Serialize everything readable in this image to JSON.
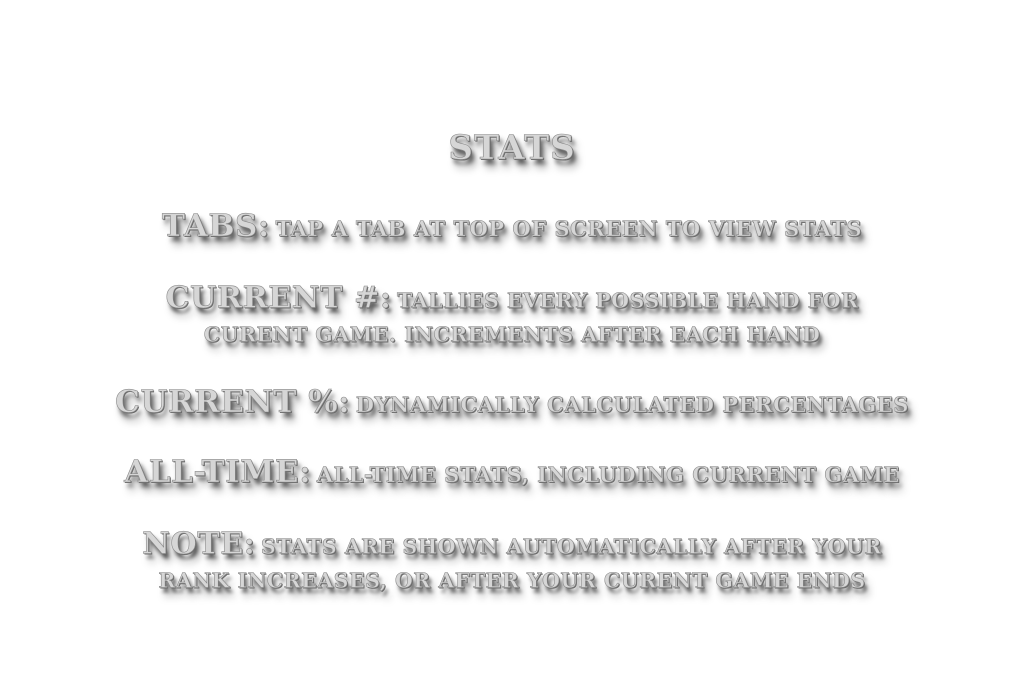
{
  "title": "STATS",
  "items": [
    {
      "key": "TABS:",
      "desc": "TAP A TAB AT TOP OF SCREEN TO VIEW STATS",
      "desc_line2": ""
    },
    {
      "key": "CURRENT #:",
      "desc": "TALLIES EVERY POSSIBLE HAND FOR",
      "desc_line2": "CURENT GAME. INCREMENTS AFTER EACH HAND"
    },
    {
      "key": "CURRENT %:",
      "desc": "DYNAMICALLY CALCULATED PERCENTAGES",
      "desc_line2": ""
    },
    {
      "key": "ALL-TIME:",
      "desc": "ALL-TIME STATS, INCLUDING CURRENT GAME",
      "desc_line2": ""
    },
    {
      "key": "NOTE:",
      "desc": "STATS ARE SHOWN AUTOMATICALLY AFTER YOUR",
      "desc_line2": "RANK INCREASES, OR AFTER YOUR CURENT GAME ENDS"
    }
  ]
}
